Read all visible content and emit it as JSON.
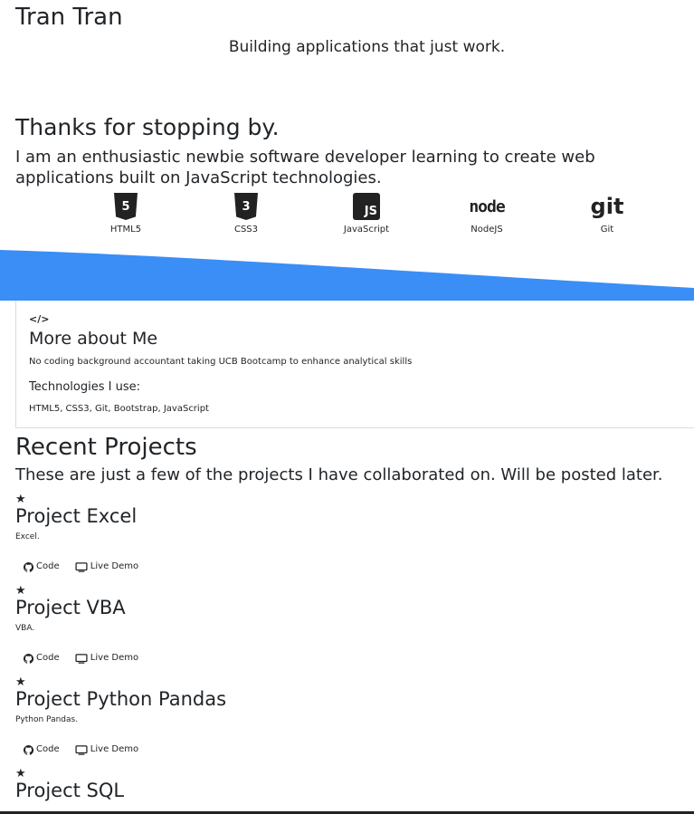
{
  "header": {
    "name": "Tran Tran",
    "tagline": "Building applications that just work."
  },
  "hero": {
    "heading": "Thanks for stopping by.",
    "intro": "I am an enthusiastic newbie software developer learning to create web applications built on JavaScript technologies.",
    "technologies": [
      {
        "label": "HTML5",
        "icon": "html5-icon",
        "glyph": "5"
      },
      {
        "label": "CSS3",
        "icon": "css3-icon",
        "glyph": "3"
      },
      {
        "label": "JavaScript",
        "icon": "javascript-icon",
        "glyph": "JS"
      },
      {
        "label": "NodeJS",
        "icon": "nodejs-icon",
        "glyph": "node"
      },
      {
        "label": "Git",
        "icon": "git-icon",
        "glyph": "git"
      }
    ],
    "wave_color": "#3a8ef6"
  },
  "about": {
    "icon": "code-icon",
    "icon_glyph": "</>",
    "title": "More about Me",
    "description": "No coding background accountant taking UCB Bootcamp to enhance analytical skills",
    "tech_heading": "Technologies I use:",
    "tech_list": "HTML5, CSS3, Git, Bootstrap, JavaScript"
  },
  "projects_section": {
    "title": "Recent Projects",
    "description": "These are just a few of the projects I have collaborated on. Will be posted later.",
    "code_label": "Code",
    "demo_label": "Live Demo",
    "star_glyph": "★",
    "items": [
      {
        "title": "Project Excel",
        "description": "Excel."
      },
      {
        "title": "Project VBA",
        "description": "VBA."
      },
      {
        "title": "Project Python Pandas",
        "description": "Python Pandas."
      },
      {
        "title": "Project SQL",
        "description": ""
      }
    ]
  }
}
